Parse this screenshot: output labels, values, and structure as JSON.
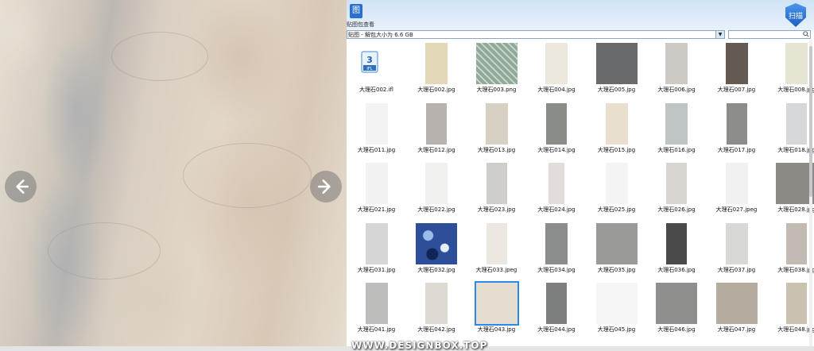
{
  "header": {
    "app_label": "贴图包查看",
    "app_icon": "图",
    "scan_label": "扫描"
  },
  "pathbar": {
    "value": "贴图 - 解包大小为 6.6 GB",
    "dropdown": "▼"
  },
  "search": {
    "placeholder": "",
    "icon": "search-icon"
  },
  "nav": {
    "prev": "arrow-left-icon",
    "next": "arrow-right-icon"
  },
  "watermark": "WWW.DESIGNBOX.TOP",
  "files": [
    {
      "name": "大理石002.ifl",
      "color": "ifl"
    },
    {
      "name": "大理石002.jpg",
      "color": "#e2d8b8",
      "shape": "tall"
    },
    {
      "name": "大理石003.png",
      "color": "#8fa898",
      "shape": "square",
      "pattern": true
    },
    {
      "name": "大理石004.jpg",
      "color": "#ece8dd",
      "shape": "tall"
    },
    {
      "name": "大理石005.jpg",
      "color": "#67696b",
      "shape": "square"
    },
    {
      "name": "大理石006.jpg",
      "color": "#cdc9c4",
      "shape": "tall"
    },
    {
      "name": "大理石007.jpg",
      "color": "#655a51",
      "shape": "tall"
    },
    {
      "name": "大理石008.jpg",
      "color": "#e6e5d4",
      "shape": "tall"
    },
    {
      "name": "大理石011.jpg",
      "color": "#f3f3f3",
      "shape": "tall"
    },
    {
      "name": "大理石012.jpg",
      "color": "#b8b2ae",
      "shape": "narrow"
    },
    {
      "name": "大理石013.jpg",
      "color": "#d8d0c2",
      "shape": "tall"
    },
    {
      "name": "大理石014.jpg",
      "color": "#8a8c88",
      "shape": "narrow"
    },
    {
      "name": "大理石015.jpg",
      "color": "#e8dfcf",
      "shape": "tall"
    },
    {
      "name": "大理石016.jpg",
      "color": "#bfc4c4",
      "shape": "tall"
    },
    {
      "name": "大理石017.jpg",
      "color": "#8c8d89",
      "shape": "narrow"
    },
    {
      "name": "大理石018.jpg",
      "color": "#d6d7d8",
      "shape": "narrow"
    },
    {
      "name": "大理石021.jpg",
      "color": "#f2f2f2",
      "shape": "tall"
    },
    {
      "name": "大理石022.jpg",
      "color": "#f0f0ef",
      "shape": "tall"
    },
    {
      "name": "大理石023.jpg",
      "color": "#cfcdc9",
      "shape": "narrow"
    },
    {
      "name": "大理石024.jpg",
      "color": "#e2dcda",
      "shape": "skinny"
    },
    {
      "name": "大理石025.jpg",
      "color": "#f4f4f4",
      "shape": "tall"
    },
    {
      "name": "大理石026.jpg",
      "color": "#d9d6d2",
      "shape": "narrow"
    },
    {
      "name": "大理石027.jpeg",
      "color": "#f1f1f1",
      "shape": "tall"
    },
    {
      "name": "大理石028.jpg",
      "color": "#8d8a86",
      "shape": "square"
    },
    {
      "name": "大理石031.jpg",
      "color": "#d6d6d6",
      "shape": "tall"
    },
    {
      "name": "大理石032.jpg",
      "color": "#2d4f9a",
      "shape": "square",
      "pattern2": true
    },
    {
      "name": "大理石033.jpeg",
      "color": "#ece8e0",
      "shape": "narrow"
    },
    {
      "name": "大理石034.jpg",
      "color": "#8b8c8c",
      "shape": "tall"
    },
    {
      "name": "大理石035.jpg",
      "color": "#9a9a98",
      "shape": "square"
    },
    {
      "name": "大理石036.jpg",
      "color": "#4a4a4b",
      "shape": "narrow"
    },
    {
      "name": "大理石037.jpg",
      "color": "#d8d8d6",
      "shape": "tall"
    },
    {
      "name": "大理石038.jpg",
      "color": "#c2bbb3",
      "shape": "narrow"
    },
    {
      "name": "大理石041.jpg",
      "color": "#bdbdbb",
      "shape": "tall"
    },
    {
      "name": "大理石042.jpg",
      "color": "#dedad2",
      "shape": "tall"
    },
    {
      "name": "大理石043.jpg",
      "color": "#e5ddd0",
      "shape": "square",
      "selected": true
    },
    {
      "name": "大理石044.jpg",
      "color": "#7d7e7e",
      "shape": "narrow"
    },
    {
      "name": "大理石045.jpg",
      "color": "#f5f5f5",
      "shape": "square"
    },
    {
      "name": "大理石046.jpg",
      "color": "#8f908e",
      "shape": "square"
    },
    {
      "name": "大理石047.jpg",
      "color": "#b5ab9e",
      "shape": "square"
    },
    {
      "name": "大理石048.jpg",
      "color": "#c9c2b0",
      "shape": "narrow"
    }
  ]
}
